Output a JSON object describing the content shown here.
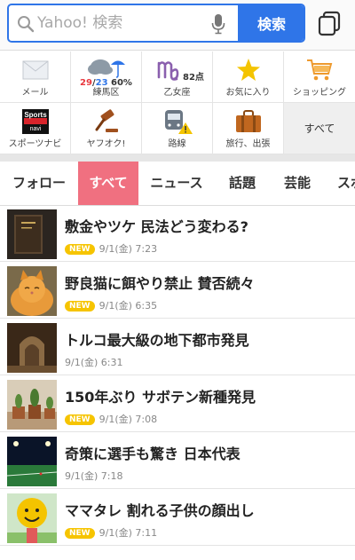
{
  "search": {
    "placeholder": "Yahoo! 検索",
    "button_label": "検索"
  },
  "shortcuts": [
    {
      "label": "メール",
      "icon": "mail-icon"
    },
    {
      "label": "練馬区",
      "icon": "weather-icon",
      "temp_high": "29",
      "temp_sep": "/",
      "temp_low": "23",
      "precip": "60%"
    },
    {
      "label": "乙女座",
      "icon": "virgo-icon",
      "score": "82点"
    },
    {
      "label": "お気に入り",
      "icon": "star-icon"
    },
    {
      "label": "ショッピング",
      "icon": "cart-icon"
    },
    {
      "label": "スポーツナビ",
      "icon": "sportsnavi-icon",
      "logo_text_top": "Sports",
      "logo_text_bottom": "navi"
    },
    {
      "label": "ヤフオク!",
      "icon": "gavel-icon"
    },
    {
      "label": "路線",
      "icon": "train-icon"
    },
    {
      "label": "旅行、出張",
      "icon": "suitcase-icon"
    },
    {
      "label": "すべて",
      "icon": ""
    }
  ],
  "tabs": [
    "フォロー",
    "すべて",
    "ニュース",
    "話題",
    "芸能",
    "スポ"
  ],
  "active_tab": "すべて",
  "articles": [
    {
      "title": "敷金やツケ 民法どう変わる?",
      "is_new": true,
      "new_label": "NEW",
      "date": "9/1(金) 7:23"
    },
    {
      "title": "野良猫に餌やり禁止 賛否続々",
      "is_new": true,
      "new_label": "NEW",
      "date": "9/1(金) 6:35"
    },
    {
      "title": "トルコ最大級の地下都市発見",
      "is_new": false,
      "new_label": "",
      "date": "9/1(金) 6:31"
    },
    {
      "title": "150年ぶり サボテン新種発見",
      "is_new": true,
      "new_label": "NEW",
      "date": "9/1(金) 7:08"
    },
    {
      "title": "奇策に選手も驚き 日本代表",
      "is_new": false,
      "new_label": "",
      "date": "9/1(金) 7:18"
    },
    {
      "title": "ママタレ 割れる子供の顔出し",
      "is_new": true,
      "new_label": "NEW",
      "date": "9/1(金) 7:11"
    }
  ],
  "colors": {
    "brand_blue": "#2f75e8",
    "active_tab": "#f07080",
    "new_badge": "#f6c400",
    "temp_high": "#e8373d",
    "temp_low": "#2f75e8"
  }
}
